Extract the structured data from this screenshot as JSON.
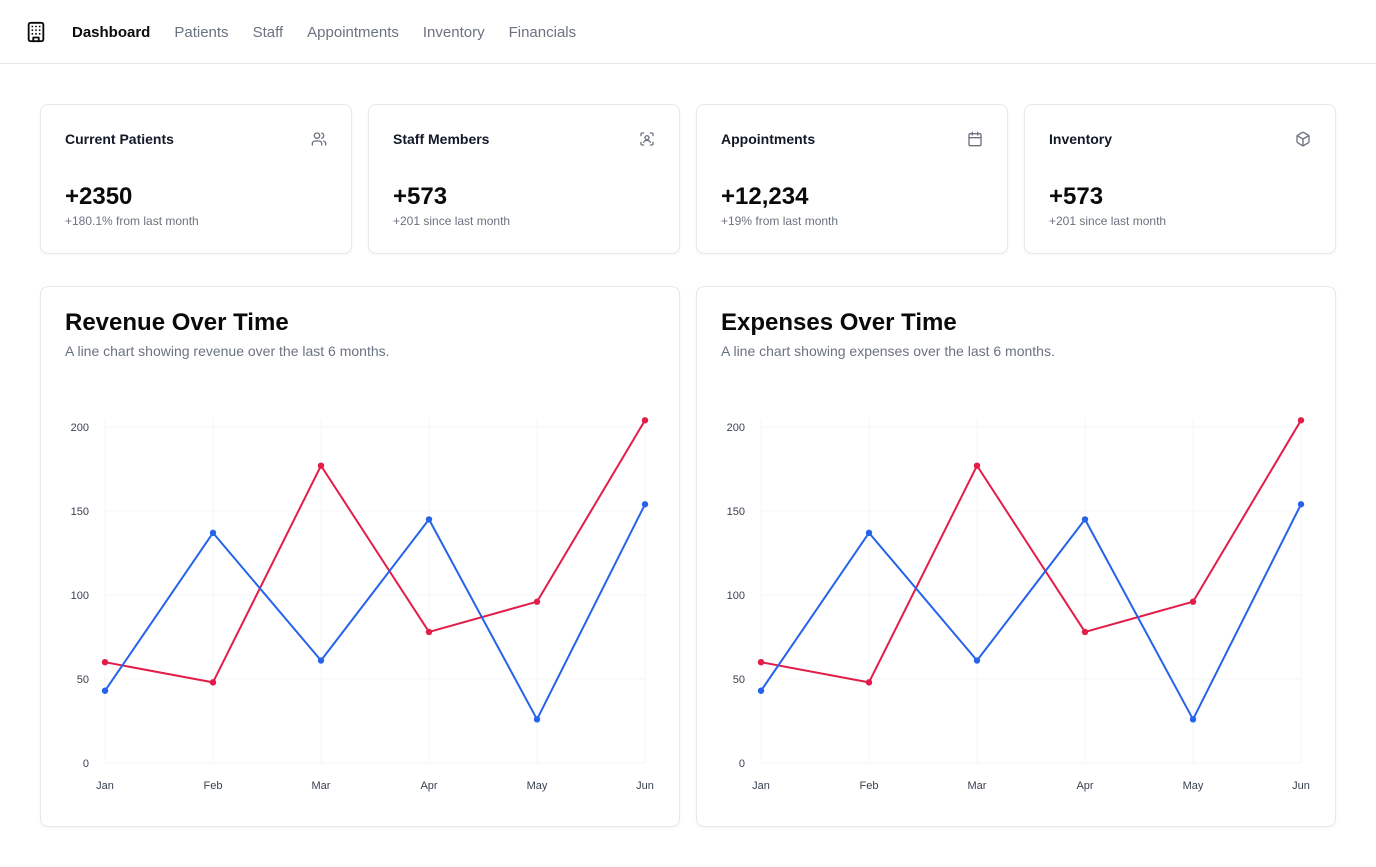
{
  "nav": {
    "logo_icon": "hospital-building-icon",
    "items": [
      {
        "label": "Dashboard",
        "active": true
      },
      {
        "label": "Patients",
        "active": false
      },
      {
        "label": "Staff",
        "active": false
      },
      {
        "label": "Appointments",
        "active": false
      },
      {
        "label": "Inventory",
        "active": false
      },
      {
        "label": "Financials",
        "active": false
      }
    ]
  },
  "stats": [
    {
      "title": "Current Patients",
      "icon": "users-icon",
      "value": "+2350",
      "sub": "+180.1% from last month"
    },
    {
      "title": "Staff Members",
      "icon": "scan-user-icon",
      "value": "+573",
      "sub": "+201 since last month"
    },
    {
      "title": "Appointments",
      "icon": "calendar-icon",
      "value": "+12,234",
      "sub": "+19% from last month"
    },
    {
      "title": "Inventory",
      "icon": "package-icon",
      "value": "+573",
      "sub": "+201 since last month"
    }
  ],
  "charts": [
    {
      "title": "Revenue Over Time",
      "subtitle": "A line chart showing revenue over the last 6 months."
    },
    {
      "title": "Expenses Over Time",
      "subtitle": "A line chart showing expenses over the last 6 months."
    }
  ],
  "colors": {
    "series_blue": "#2563eb",
    "series_red": "#e11d48",
    "grid": "#f3f4f6"
  },
  "chart_data": [
    {
      "type": "line",
      "title": "Revenue Over Time",
      "categories": [
        "Jan",
        "Feb",
        "Mar",
        "Apr",
        "May",
        "Jun"
      ],
      "ylim": [
        0,
        200
      ],
      "yticks": [
        0,
        50,
        100,
        150,
        200
      ],
      "grid": true,
      "series": [
        {
          "color": "#e11d48",
          "values": [
            60,
            48,
            177,
            78,
            96,
            204
          ]
        },
        {
          "color": "#2563eb",
          "values": [
            43,
            137,
            61,
            145,
            26,
            154
          ]
        }
      ]
    },
    {
      "type": "line",
      "title": "Expenses Over Time",
      "categories": [
        "Jan",
        "Feb",
        "Mar",
        "Apr",
        "May",
        "Jun"
      ],
      "ylim": [
        0,
        200
      ],
      "yticks": [
        0,
        50,
        100,
        150,
        200
      ],
      "grid": true,
      "series": [
        {
          "color": "#e11d48",
          "values": [
            60,
            48,
            177,
            78,
            96,
            204
          ]
        },
        {
          "color": "#2563eb",
          "values": [
            43,
            137,
            61,
            145,
            26,
            154
          ]
        }
      ]
    }
  ]
}
